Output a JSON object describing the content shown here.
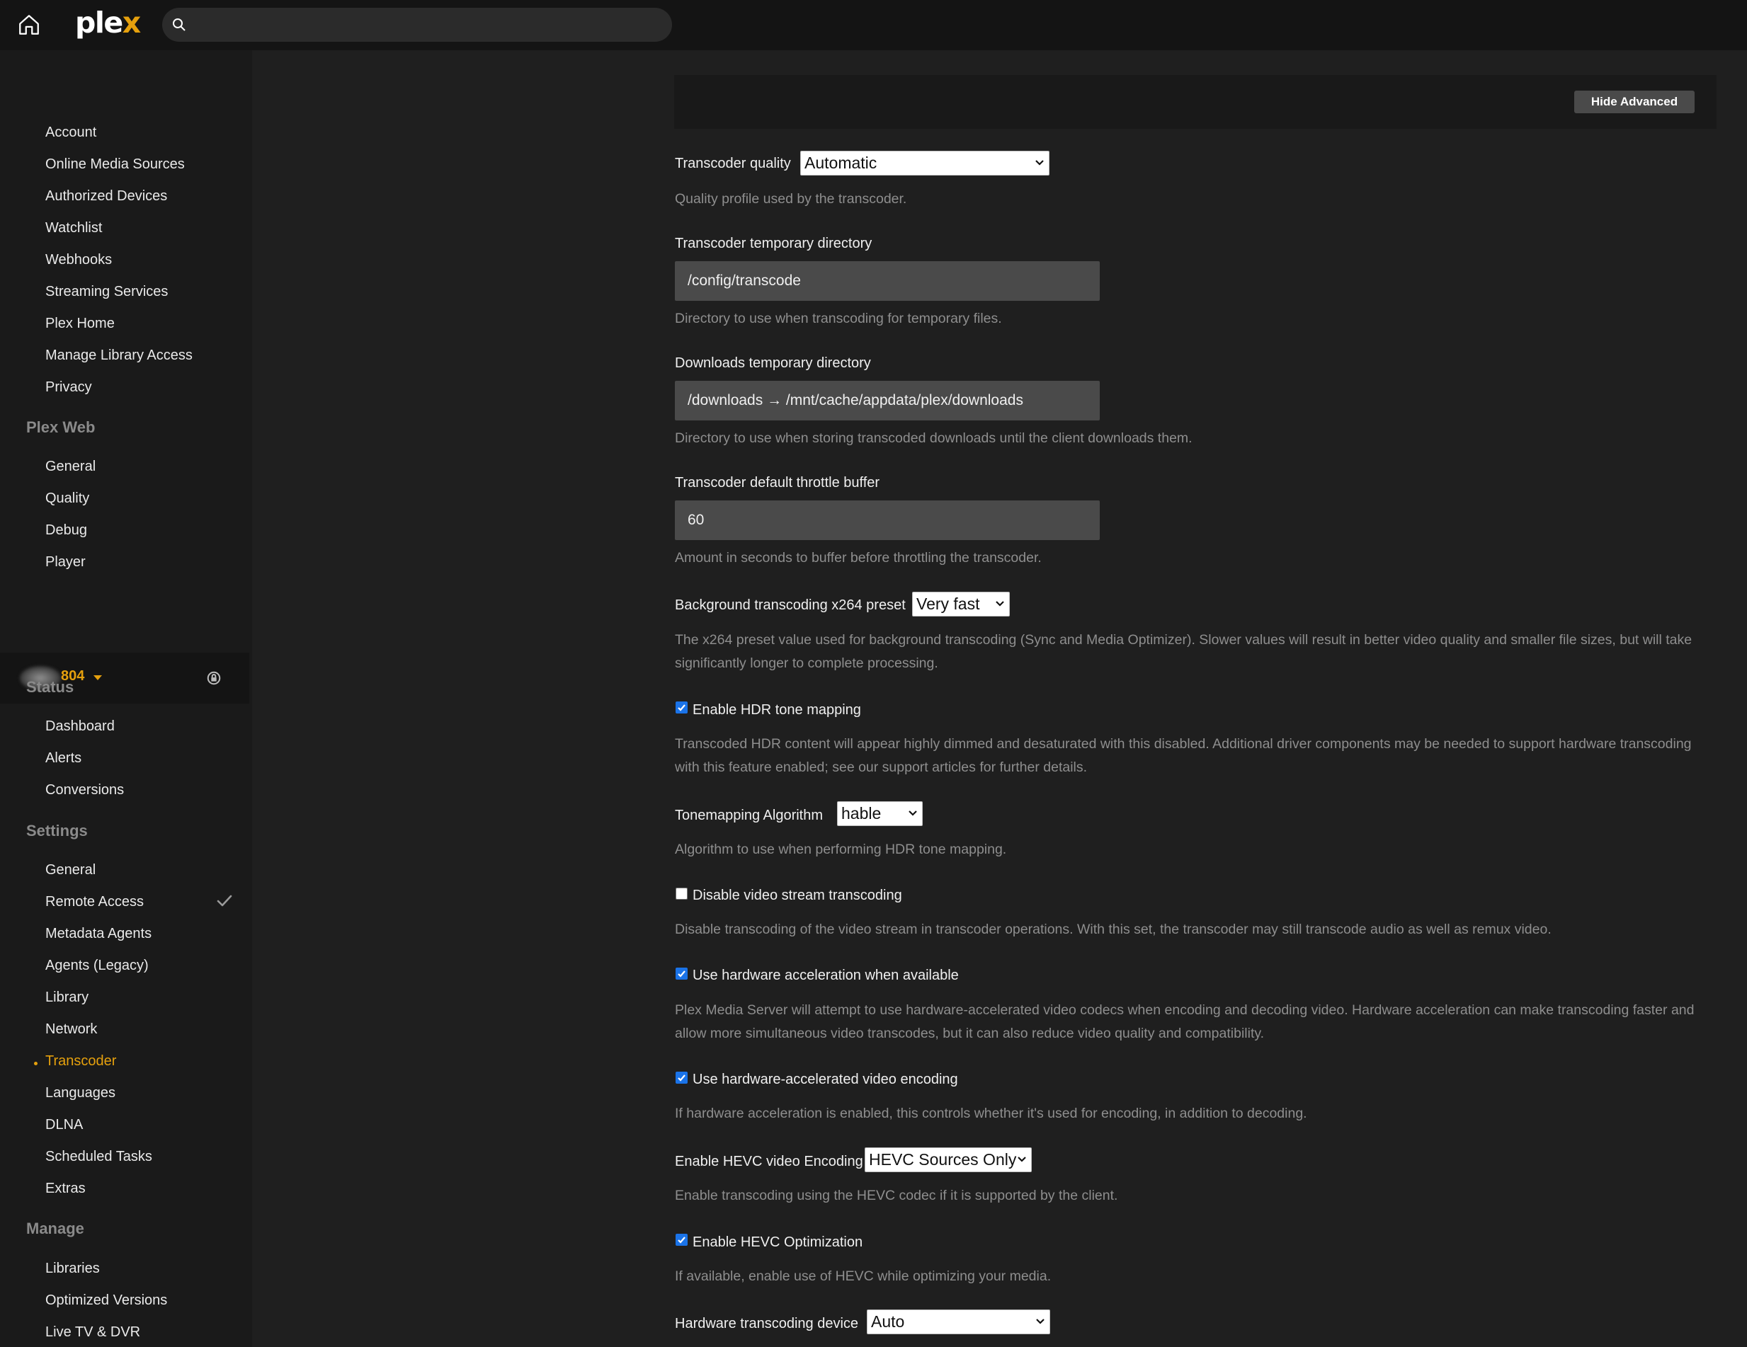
{
  "app": {
    "logo_prefix": "ple",
    "logo_suffix": "x"
  },
  "search": {
    "placeholder": ""
  },
  "sidebar": {
    "account_items": [
      {
        "label": "Account"
      },
      {
        "label": "Online Media Sources"
      },
      {
        "label": "Authorized Devices"
      },
      {
        "label": "Watchlist"
      },
      {
        "label": "Webhooks"
      },
      {
        "label": "Streaming Services"
      },
      {
        "label": "Plex Home"
      },
      {
        "label": "Manage Library Access"
      },
      {
        "label": "Privacy"
      }
    ],
    "plex_web_header": "Plex Web",
    "plex_web_items": [
      {
        "label": "General"
      },
      {
        "label": "Quality"
      },
      {
        "label": "Debug"
      },
      {
        "label": "Player"
      }
    ],
    "server_name": "804",
    "status_header": "Status",
    "status_items": [
      {
        "label": "Dashboard"
      },
      {
        "label": "Alerts"
      },
      {
        "label": "Conversions"
      }
    ],
    "settings_header": "Settings",
    "settings_items": [
      {
        "label": "General"
      },
      {
        "label": "Remote Access"
      },
      {
        "label": "Metadata Agents"
      },
      {
        "label": "Agents (Legacy)"
      },
      {
        "label": "Library"
      },
      {
        "label": "Network"
      },
      {
        "label": "Transcoder"
      },
      {
        "label": "Languages"
      },
      {
        "label": "DLNA"
      },
      {
        "label": "Scheduled Tasks"
      },
      {
        "label": "Extras"
      }
    ],
    "manage_header": "Manage",
    "manage_items": [
      {
        "label": "Libraries"
      },
      {
        "label": "Optimized Versions"
      },
      {
        "label": "Live TV & DVR"
      }
    ]
  },
  "colors": {
    "accent": "#e5a00d",
    "checkbox": "#1a73e8"
  },
  "main": {
    "hide_advanced_label": "Hide Advanced",
    "transcoder_quality": {
      "label": "Transcoder quality",
      "value": "Automatic",
      "help": "Quality profile used by the transcoder."
    },
    "temp_dir": {
      "label": "Transcoder temporary directory",
      "value": "/config/transcode",
      "help": "Directory to use when transcoding for temporary files."
    },
    "downloads_dir": {
      "label": "Downloads temporary directory",
      "value": "/downloads → /mnt/cache/appdata/plex/downloads",
      "help": "Directory to use when storing transcoded downloads until the client downloads them."
    },
    "throttle": {
      "label": "Transcoder default throttle buffer",
      "value": "60",
      "help": "Amount in seconds to buffer before throttling the transcoder."
    },
    "x264_preset": {
      "label": "Background transcoding x264 preset",
      "value": "Very fast",
      "help": "The x264 preset value used for background transcoding (Sync and Media Optimizer). Slower values will result in better video quality and smaller file sizes, but will take significantly longer to complete processing."
    },
    "hdr_tone": {
      "label": "Enable HDR tone mapping",
      "checked": true,
      "help": "Transcoded HDR content will appear highly dimmed and desaturated with this disabled. Additional driver components may be needed to support hardware transcoding with this feature enabled; see our support articles for further details."
    },
    "tonemap_algo": {
      "label": "Tonemapping Algorithm",
      "value": "hable",
      "help": "Algorithm to use when performing HDR tone mapping."
    },
    "disable_video": {
      "label": "Disable video stream transcoding",
      "checked": false,
      "help": "Disable transcoding of the video stream in transcoder operations. With this set, the transcoder may still transcode audio as well as remux video."
    },
    "hw_accel": {
      "label": "Use hardware acceleration when available",
      "checked": true,
      "help": "Plex Media Server will attempt to use hardware-accelerated video codecs when encoding and decoding video. Hardware acceleration can make transcoding faster and allow more simultaneous video transcodes, but it can also reduce video quality and compatibility."
    },
    "hw_encoding": {
      "label": "Use hardware-accelerated video encoding",
      "checked": true,
      "help": "If hardware acceleration is enabled, this controls whether it's used for encoding, in addition to decoding."
    },
    "hevc_encoding": {
      "label": "Enable HEVC video Encoding",
      "value": "HEVC Sources Only",
      "help": "Enable transcoding using the HEVC codec if it is supported by the client."
    },
    "hevc_opt": {
      "label": "Enable HEVC Optimization",
      "checked": true,
      "help": "If available, enable use of HEVC while optimizing your media."
    },
    "hw_device": {
      "label": "Hardware transcoding device",
      "value": "Auto"
    }
  }
}
